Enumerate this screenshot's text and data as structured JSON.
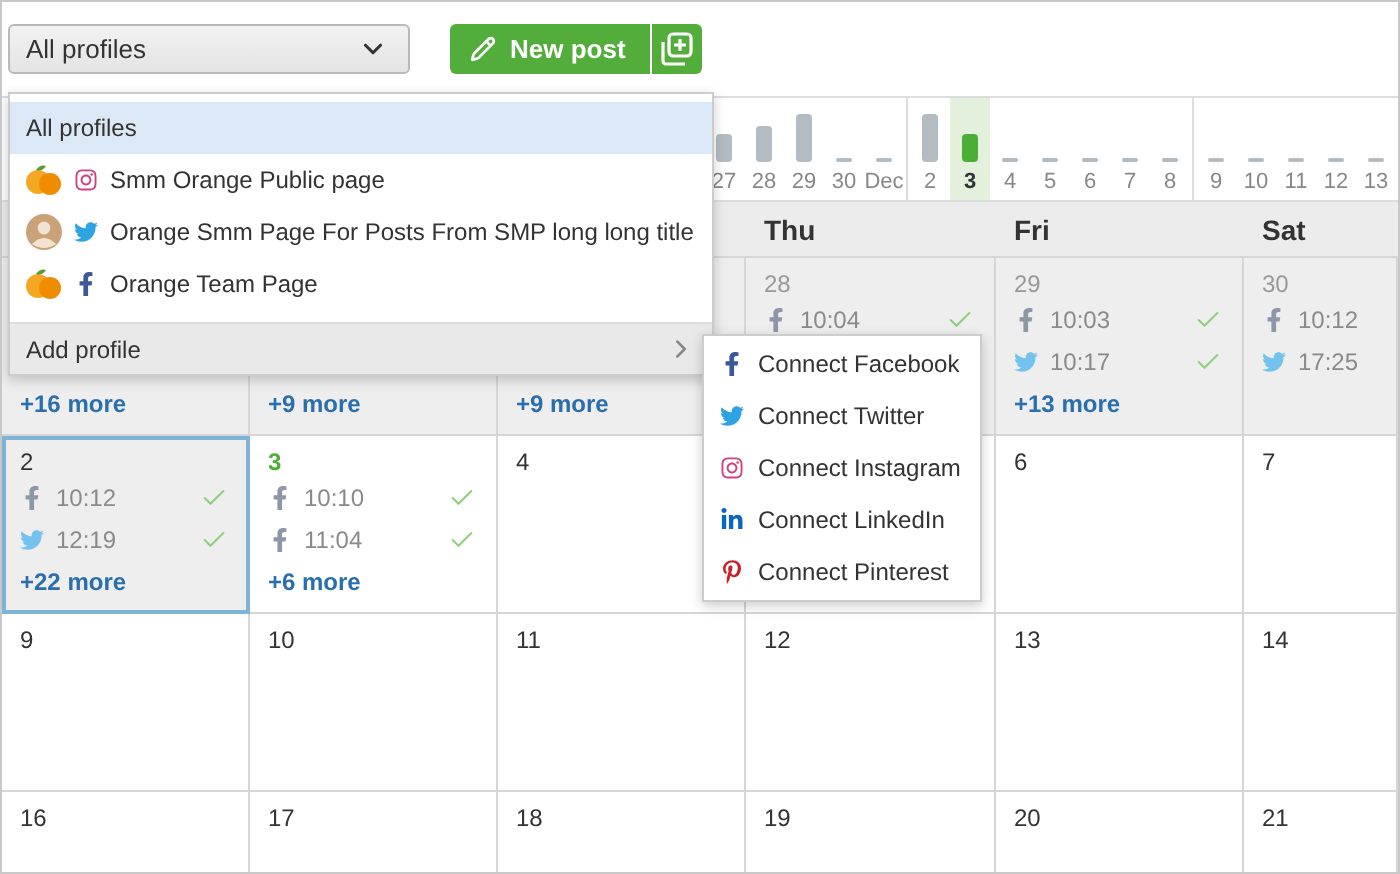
{
  "profile_select": {
    "value": "All profiles"
  },
  "new_post": {
    "label": "New post"
  },
  "timeline": {
    "weeks": [
      {
        "days": [
          {
            "label": "27",
            "kind": "low",
            "selected": false
          },
          {
            "label": "28",
            "kind": "mid",
            "selected": false
          },
          {
            "label": "29",
            "kind": "high",
            "selected": false
          },
          {
            "label": "30",
            "kind": "none",
            "selected": false
          },
          {
            "label": "Dec",
            "kind": "none",
            "selected": false
          }
        ]
      },
      {
        "days": [
          {
            "label": "2",
            "kind": "high",
            "selected": false
          },
          {
            "label": "3",
            "kind": "low",
            "selected": true
          },
          {
            "label": "4",
            "kind": "none",
            "selected": false
          },
          {
            "label": "5",
            "kind": "none",
            "selected": false
          },
          {
            "label": "6",
            "kind": "none",
            "selected": false
          },
          {
            "label": "7",
            "kind": "none",
            "selected": false
          },
          {
            "label": "8",
            "kind": "none",
            "selected": false
          }
        ]
      },
      {
        "days": [
          {
            "label": "9",
            "kind": "none",
            "selected": false
          },
          {
            "label": "10",
            "kind": "none",
            "selected": false
          },
          {
            "label": "11",
            "kind": "none",
            "selected": false
          },
          {
            "label": "12",
            "kind": "none",
            "selected": false
          },
          {
            "label": "13",
            "kind": "none",
            "selected": false
          }
        ]
      }
    ]
  },
  "weekdays": [
    "Thu",
    "Fri",
    "Sat"
  ],
  "calendar": {
    "weeks": [
      {
        "cells": [
          {
            "past": true,
            "selected": false,
            "more": "+16 more"
          },
          {
            "past": true,
            "selected": false,
            "more": "+9 more"
          },
          {
            "past": true,
            "selected": false,
            "more": "+9 more"
          },
          {
            "date": "28",
            "past": true,
            "selected": false,
            "today": false,
            "posts": [
              {
                "kind": "facebook",
                "time": "10:04",
                "published": true
              }
            ]
          },
          {
            "date": "29",
            "past": true,
            "selected": false,
            "today": false,
            "posts": [
              {
                "kind": "facebook",
                "time": "10:03",
                "published": true
              },
              {
                "kind": "twitter",
                "time": "10:17",
                "published": true
              }
            ],
            "more": "+13 more"
          },
          {
            "date": "30",
            "past": true,
            "selected": false,
            "today": false,
            "posts": [
              {
                "kind": "facebook",
                "time": "10:12",
                "published": false
              },
              {
                "kind": "twitter",
                "time": "17:25",
                "published": false
              }
            ]
          }
        ]
      },
      {
        "cells": [
          {
            "date": "2",
            "past": true,
            "selected": true,
            "today": false,
            "posts": [
              {
                "kind": "facebook",
                "time": "10:12",
                "published": true
              },
              {
                "kind": "twitter",
                "time": "12:19",
                "published": true
              }
            ],
            "more": "+22 more"
          },
          {
            "date": "3",
            "past": false,
            "selected": false,
            "today": true,
            "posts": [
              {
                "kind": "facebook",
                "time": "10:10",
                "published": true
              },
              {
                "kind": "facebook",
                "time": "11:04",
                "published": true
              }
            ],
            "more": "+6 more"
          },
          {
            "date": "4",
            "past": false,
            "selected": false,
            "today": false
          },
          {
            "past": false,
            "selected": false
          },
          {
            "date": "6",
            "past": false,
            "selected": false,
            "today": false
          },
          {
            "date": "7",
            "past": false,
            "selected": false,
            "today": false
          }
        ]
      },
      {
        "cells": [
          {
            "date": "9",
            "past": false,
            "selected": false,
            "today": false
          },
          {
            "date": "10",
            "past": false,
            "selected": false,
            "today": false
          },
          {
            "date": "11",
            "past": false,
            "selected": false,
            "today": false
          },
          {
            "date": "12",
            "past": false,
            "selected": false,
            "today": false
          },
          {
            "date": "13",
            "past": false,
            "selected": false,
            "today": false
          },
          {
            "date": "14",
            "past": false,
            "selected": false,
            "today": false
          }
        ]
      },
      {
        "cells": [
          {
            "date": "16",
            "past": false,
            "selected": false,
            "today": false
          },
          {
            "date": "17",
            "past": false,
            "selected": false,
            "today": false
          },
          {
            "date": "18",
            "past": false,
            "selected": false,
            "today": false
          },
          {
            "date": "19",
            "past": false,
            "selected": false,
            "today": false
          },
          {
            "date": "20",
            "past": false,
            "selected": false,
            "today": false
          },
          {
            "date": "21",
            "past": false,
            "selected": false,
            "today": false
          }
        ]
      }
    ]
  },
  "profile_menu": {
    "items": [
      {
        "label": "All profiles",
        "selected": true
      },
      {
        "label": "Smm Orange Public page",
        "avatar": {
          "kind": "orange"
        },
        "icon": {
          "kind": "instagram"
        },
        "selected": false
      },
      {
        "label": "Orange Smm Page For Posts From SMP long long title",
        "avatar": {
          "kind": "person"
        },
        "icon": {
          "kind": "twitter"
        },
        "selected": false
      },
      {
        "label": "Orange Team Page",
        "avatar": {
          "kind": "orange"
        },
        "icon": {
          "kind": "facebook"
        },
        "selected": false
      }
    ],
    "add_profile": {
      "label": "Add profile",
      "highlighted": true
    }
  },
  "connect_menu": {
    "items": [
      {
        "label": "Connect Facebook",
        "kind": "facebook"
      },
      {
        "label": "Connect Twitter",
        "kind": "twitter"
      },
      {
        "label": "Connect Instagram",
        "kind": "instagram"
      },
      {
        "label": "Connect LinkedIn",
        "kind": "linkedin"
      },
      {
        "label": "Connect Pinterest",
        "kind": "pinterest"
      }
    ]
  }
}
